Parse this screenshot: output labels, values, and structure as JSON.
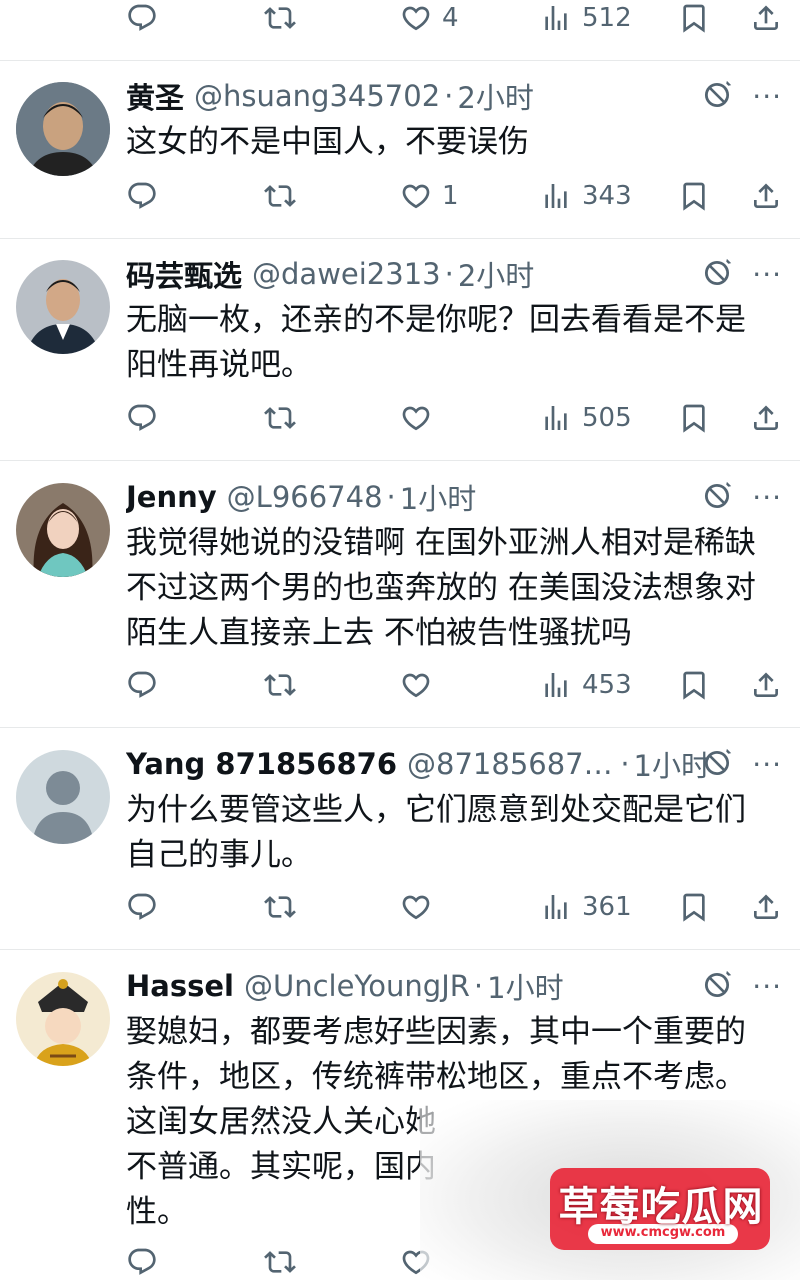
{
  "top_actions": {
    "like_count": "4",
    "views_count": "512"
  },
  "tweets": [
    {
      "name": "黄圣",
      "handle": "@hsuang345702",
      "time": "2小时",
      "text": [
        "这女的不是中国人，不要误伤"
      ],
      "like_count": "1",
      "views_count": "343"
    },
    {
      "name": "码芸甄选",
      "handle": "@dawei2313",
      "time": "2小时",
      "text": [
        "无脑一枚，还亲的不是你呢？回去看看是不是",
        "阳性再说吧。"
      ],
      "like_count": "",
      "views_count": "505"
    },
    {
      "name": "Jenny",
      "handle": "@L966748",
      "time": "1小时",
      "text": [
        "我觉得她说的没错啊 在国外亚洲人相对是稀缺",
        "不过这两个男的也蛮奔放的 在美国没法想象对",
        "陌生人直接亲上去 不怕被告性骚扰吗"
      ],
      "like_count": "",
      "views_count": "453"
    },
    {
      "name": "Yang 871856876",
      "handle": "@871856876...",
      "time": "1小时",
      "text": [
        "为什么要管这些人，它们愿意到处交配是它们",
        "自己的事儿。"
      ],
      "like_count": "",
      "views_count": "361"
    },
    {
      "name": "Hassel",
      "handle": "@UncleYoungJR",
      "time": "1小时",
      "text": [
        "娶媳妇，都要考虑好些因素，其中一个重要的",
        "条件，地区，传统裤带松地区，重点不考虑。",
        "这闺女居然没人关心她",
        "不普通。其实呢，国内",
        "性。"
      ]
    }
  ],
  "separator": "·",
  "more_glyph": "···",
  "watermark": {
    "title": "草莓吃瓜网",
    "url": "www.cmcgw.com"
  },
  "colors": {
    "text": "#0f1419",
    "muted": "#536471",
    "divider": "#e7e9ea",
    "watermark_red": "#e8283a"
  }
}
